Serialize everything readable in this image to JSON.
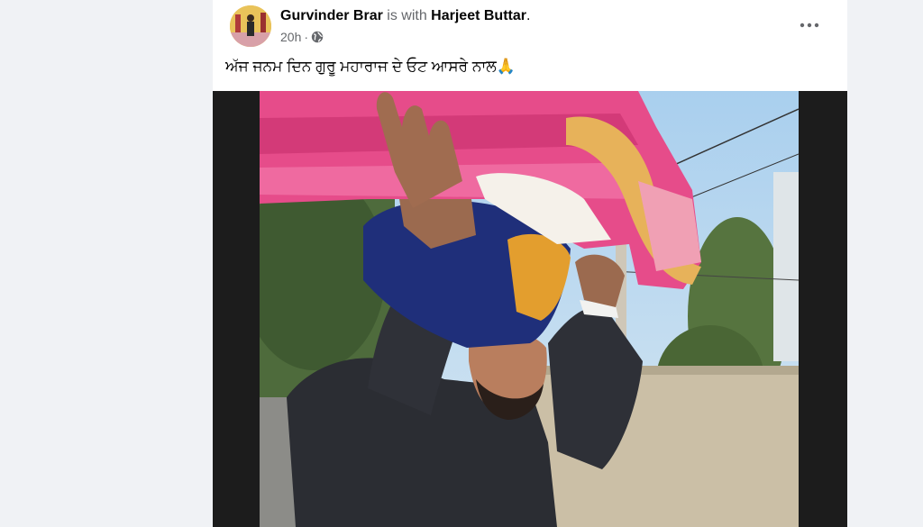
{
  "post": {
    "author": "Gurvinder Brar",
    "connector": "is with",
    "tagged": "Harjeet Buttar",
    "tagged_suffix": ".",
    "timestamp": "20h",
    "separator": "·",
    "privacy_icon": "globe-icon",
    "more_icon": "more-dots-icon",
    "caption": "ਅੱਜ ਜਨਮ ਦਿਨ ਗੁਰੂ ਮਹਾਰਾਜ ਦੇ ਓਟ ਆਸਰੇ ਨਾਲ🙏"
  },
  "colors": {
    "page_bg": "#f0f2f5",
    "card_bg": "#ffffff",
    "primary_text": "#050505",
    "secondary_text": "#65676b"
  }
}
